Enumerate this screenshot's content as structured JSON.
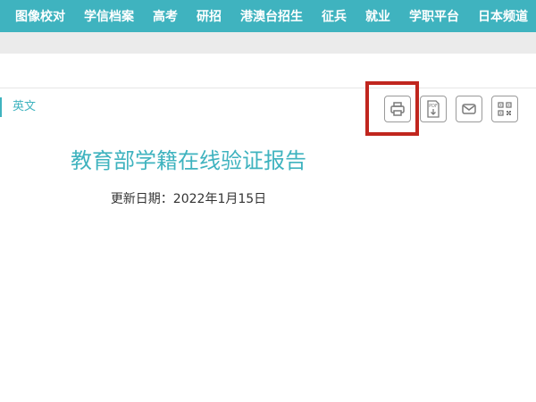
{
  "nav": {
    "items": [
      {
        "label": "图像校对"
      },
      {
        "label": "学信档案"
      },
      {
        "label": "高考"
      },
      {
        "label": "研招"
      },
      {
        "label": "港澳台招生"
      },
      {
        "label": "征兵"
      },
      {
        "label": "就业"
      },
      {
        "label": "学职平台"
      },
      {
        "label": "日本频道"
      }
    ]
  },
  "lang_link": "英文",
  "toolbar": {
    "buttons": [
      {
        "icon": "printer-icon"
      },
      {
        "icon": "pdf-download-icon"
      },
      {
        "icon": "mail-icon"
      },
      {
        "icon": "qr-code-icon"
      }
    ]
  },
  "report": {
    "title": "教育部学籍在线验证报告",
    "update_date": "更新日期：2022年1月15日"
  },
  "colors": {
    "accent": "#3fb3bf",
    "highlight": "#c0261e",
    "icon": "#7a7a7a"
  }
}
